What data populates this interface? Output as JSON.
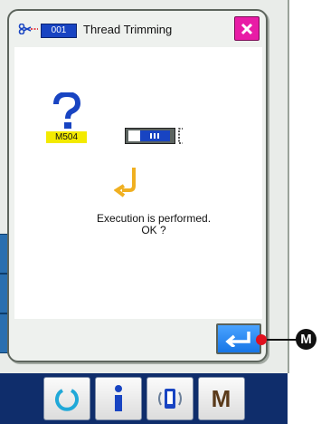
{
  "dialog": {
    "code": "001",
    "title": "Thread Trimming",
    "message_code": "M504",
    "message_line1": "Execution is performed.",
    "message_line2": "OK ?"
  },
  "callout": {
    "marker": "M"
  },
  "taskbar": {
    "m_label": "M"
  },
  "colors": {
    "title_badge": "#1844c2",
    "close_button": "#e81ca6",
    "message_badge": "#f3ea00",
    "question_mark": "#1844c2",
    "enter_button": "#1675e6",
    "arrow": "#f0b021",
    "taskbar": "#0f2d6b",
    "callout_dot": "#e0101d"
  },
  "icons": {
    "title": "thread-trimming-icon",
    "close": "close-icon",
    "question": "question-mark-icon",
    "connector": "memory-connector-icon",
    "arrow": "insert-arrow-icon",
    "enter": "enter-icon",
    "taskbar": [
      "power-icon",
      "info-icon",
      "communication-icon",
      "m-mode-icon"
    ]
  }
}
